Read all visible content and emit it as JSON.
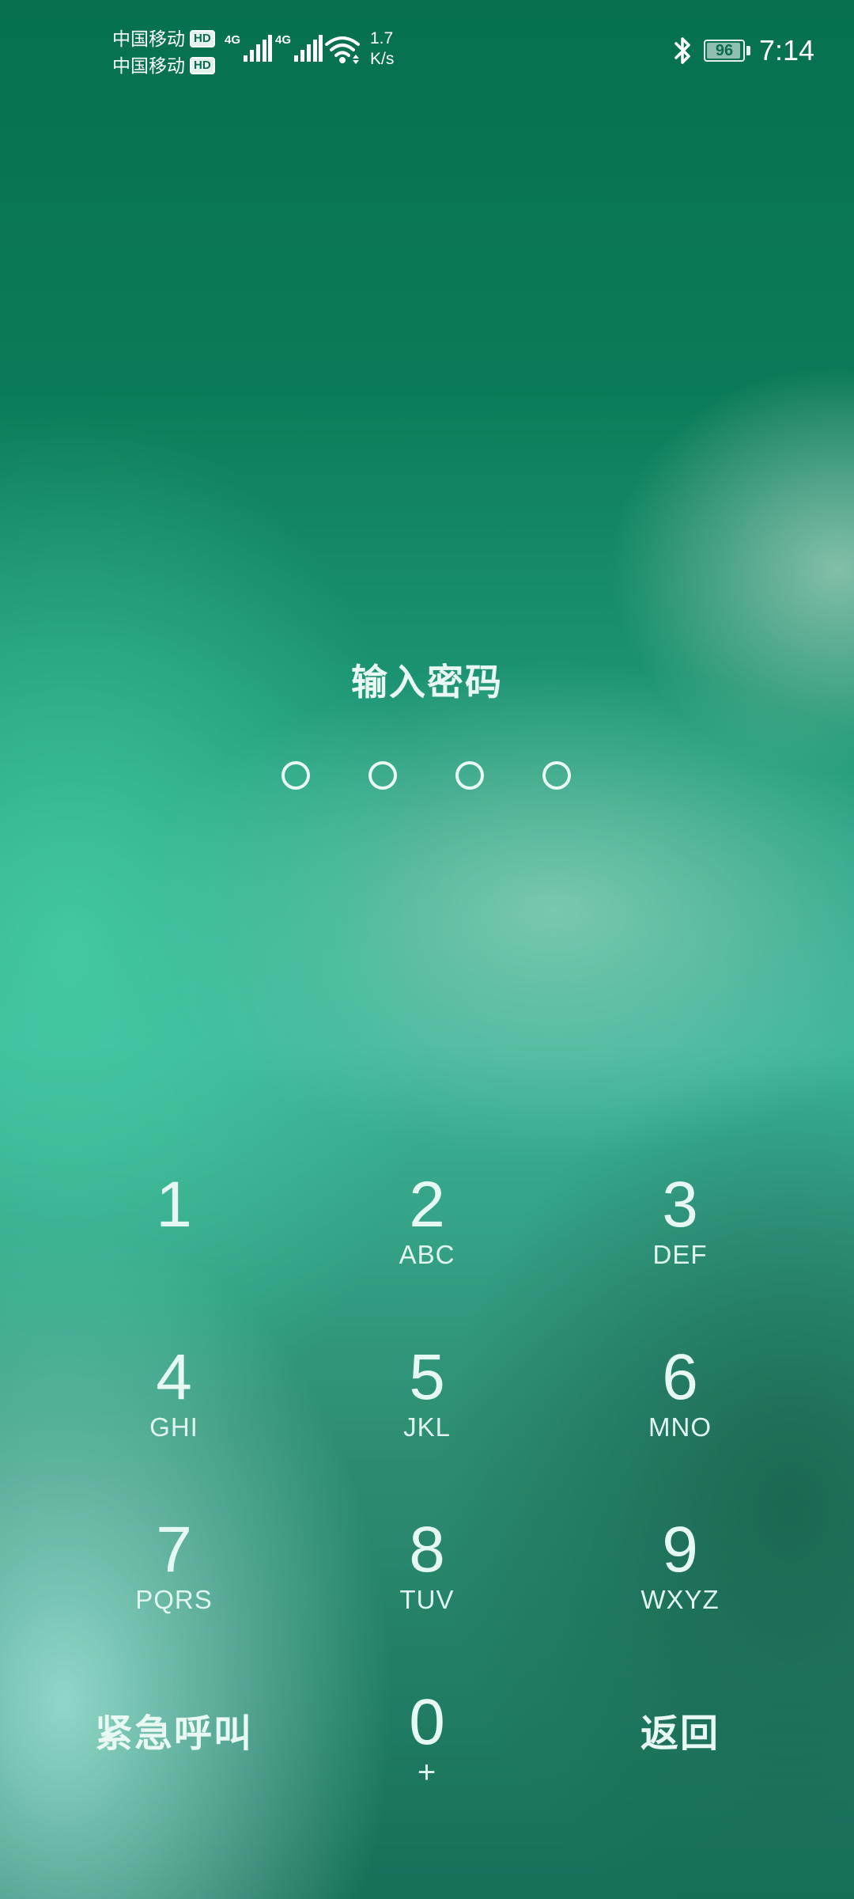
{
  "status_bar": {
    "carriers": [
      {
        "name": "中国移动",
        "badge": "HD"
      },
      {
        "name": "中国移动",
        "badge": "HD"
      }
    ],
    "network_type_1": "4G",
    "network_type_2": "4G",
    "speed_value": "1.7",
    "speed_unit": "K/s",
    "battery_level": "96",
    "battery_fraction": 0.96,
    "time": "7:14",
    "icons": [
      "signal-icon",
      "wifi-icon",
      "bluetooth-icon",
      "battery-icon"
    ]
  },
  "lock_screen": {
    "prompt": "输入密码",
    "pin_length": 4,
    "pin_entered": 0
  },
  "keypad": {
    "keys": [
      {
        "digit": "1",
        "letters": ""
      },
      {
        "digit": "2",
        "letters": "ABC"
      },
      {
        "digit": "3",
        "letters": "DEF"
      },
      {
        "digit": "4",
        "letters": "GHI"
      },
      {
        "digit": "5",
        "letters": "JKL"
      },
      {
        "digit": "6",
        "letters": "MNO"
      },
      {
        "digit": "7",
        "letters": "PQRS"
      },
      {
        "digit": "8",
        "letters": "TUV"
      },
      {
        "digit": "9",
        "letters": "WXYZ"
      },
      {
        "digit": "0",
        "letters": "+"
      }
    ],
    "emergency_label": "紧急呼叫",
    "back_label": "返回"
  },
  "colors": {
    "background_top": "#06704f",
    "background_mid": "#3bb496",
    "text": "#e8f8f2"
  }
}
